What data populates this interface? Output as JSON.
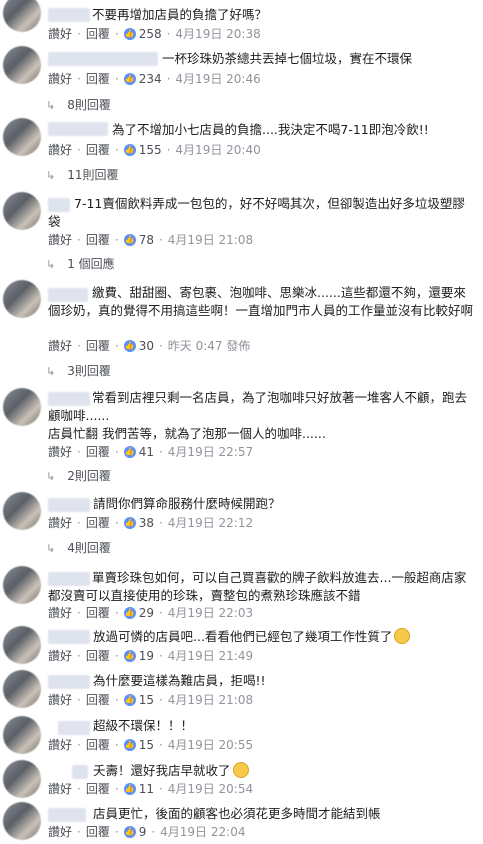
{
  "ui": {
    "like_label": "讚好",
    "reply_label": "回覆",
    "replies_suffix": "回覆",
    "sep": "·"
  },
  "comments": [
    {
      "text": "不要再增加店員的負擔了好嗎？",
      "likes": "258",
      "time": "4月19日 20:38",
      "replies": null
    },
    {
      "text": "一杯珍珠奶茶總共丟掉七個垃圾，實在不環保",
      "likes": "234",
      "time": "4月19日 20:46",
      "replies": "8則回覆"
    },
    {
      "text": "為了不增加小七店員的負擔....我決定不喝7-11即泡冷飲!!",
      "likes": "155",
      "time": "4月19日 20:40",
      "replies": "11則回覆"
    },
    {
      "text": "7-11賣個飲料弄成一包包的，好不好喝其次，但卻製造出好多垃圾塑膠袋",
      "likes": "78",
      "time": "4月19日 21:08",
      "replies": "1 個回應"
    },
    {
      "text": "繳費、甜甜圈、寄包裹、泡咖啡、思樂冰......這些都還不夠，還要來個珍奶，真的覺得不用搞這些啊！一直增加門市人員的工作量並沒有比較好啊",
      "likes": "30",
      "time": "昨天 0:47 發佈",
      "replies": "3則回覆"
    },
    {
      "text": "常看到店裡只剩一名店員，為了泡咖啡只好放著一堆客人不顧，跑去顧咖啡......\n店員忙翻 我們苦等，就為了泡那一個人的咖啡......",
      "likes": "41",
      "time": "4月19日 22:57",
      "replies": "2則回覆"
    },
    {
      "text": "請問你們算命服務什麼時候開跑？",
      "likes": "38",
      "time": "4月19日 22:12",
      "replies": "4則回覆"
    },
    {
      "text": "單賣珍珠包如何，可以自己買喜歡的牌子飲料放進去...一般超商店家都沒賣可以直接使用的珍珠，賣整包的煮熟珍珠應該不錯",
      "likes": "29",
      "time": "4月19日 22:03",
      "replies": null
    },
    {
      "text": "放過可憐的店員吧...看看他們已經包了幾項工作性質了",
      "likes": "19",
      "time": "4月19日 21:49",
      "replies": null,
      "emoji": "worried-face"
    },
    {
      "text": "為什麼要這樣為難店員，拒喝!!",
      "likes": "15",
      "time": "4月19日 21:08",
      "replies": null
    },
    {
      "text": "超級不環保！！！",
      "likes": "15",
      "time": "4月19日 20:55",
      "replies": null
    },
    {
      "text": "夭壽！還好我店早就收了",
      "likes": "11",
      "time": "4月19日 20:54",
      "replies": null,
      "emoji": "grinning-face"
    },
    {
      "text": "店員更忙，後面的顧客也必須花更多時間才能結到帳",
      "likes": "9",
      "time": "4月19日 22:04",
      "replies": null
    }
  ]
}
